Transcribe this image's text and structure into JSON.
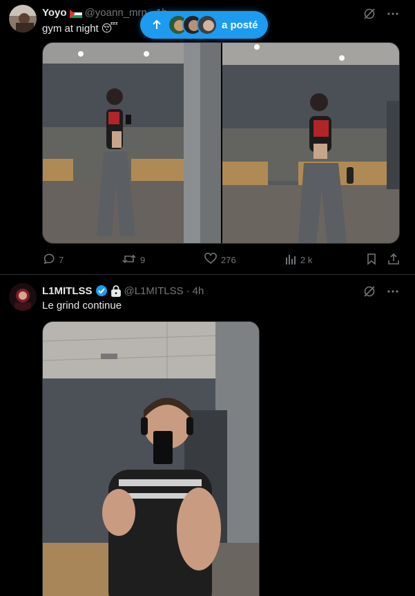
{
  "colors": {
    "accent": "#1d9bf0",
    "muted": "#71767b",
    "text": "#e7e9ea",
    "border": "#2f3336",
    "verified": "#1d9bf0"
  },
  "new_posts_pill": {
    "label": "a posté",
    "icon": "arrow-up-icon"
  },
  "tweets": [
    {
      "display_name": "Yoyo",
      "flag_icon": "palestine-flag-icon",
      "handle": "@yoann_mrn",
      "time_sep": "·",
      "time": "1h",
      "text": "gym at night",
      "emoji": "😴",
      "stats": {
        "replies": "7",
        "reposts": "9",
        "likes": "276",
        "views": "2 k"
      }
    },
    {
      "display_name": "L1MITLSS",
      "handle": "@L1MITLSS",
      "time_sep": "·",
      "time": "4h",
      "text": "Le grind continue",
      "verified_icon": "verified-badge-icon",
      "lock_icon": "lock-icon"
    }
  ]
}
